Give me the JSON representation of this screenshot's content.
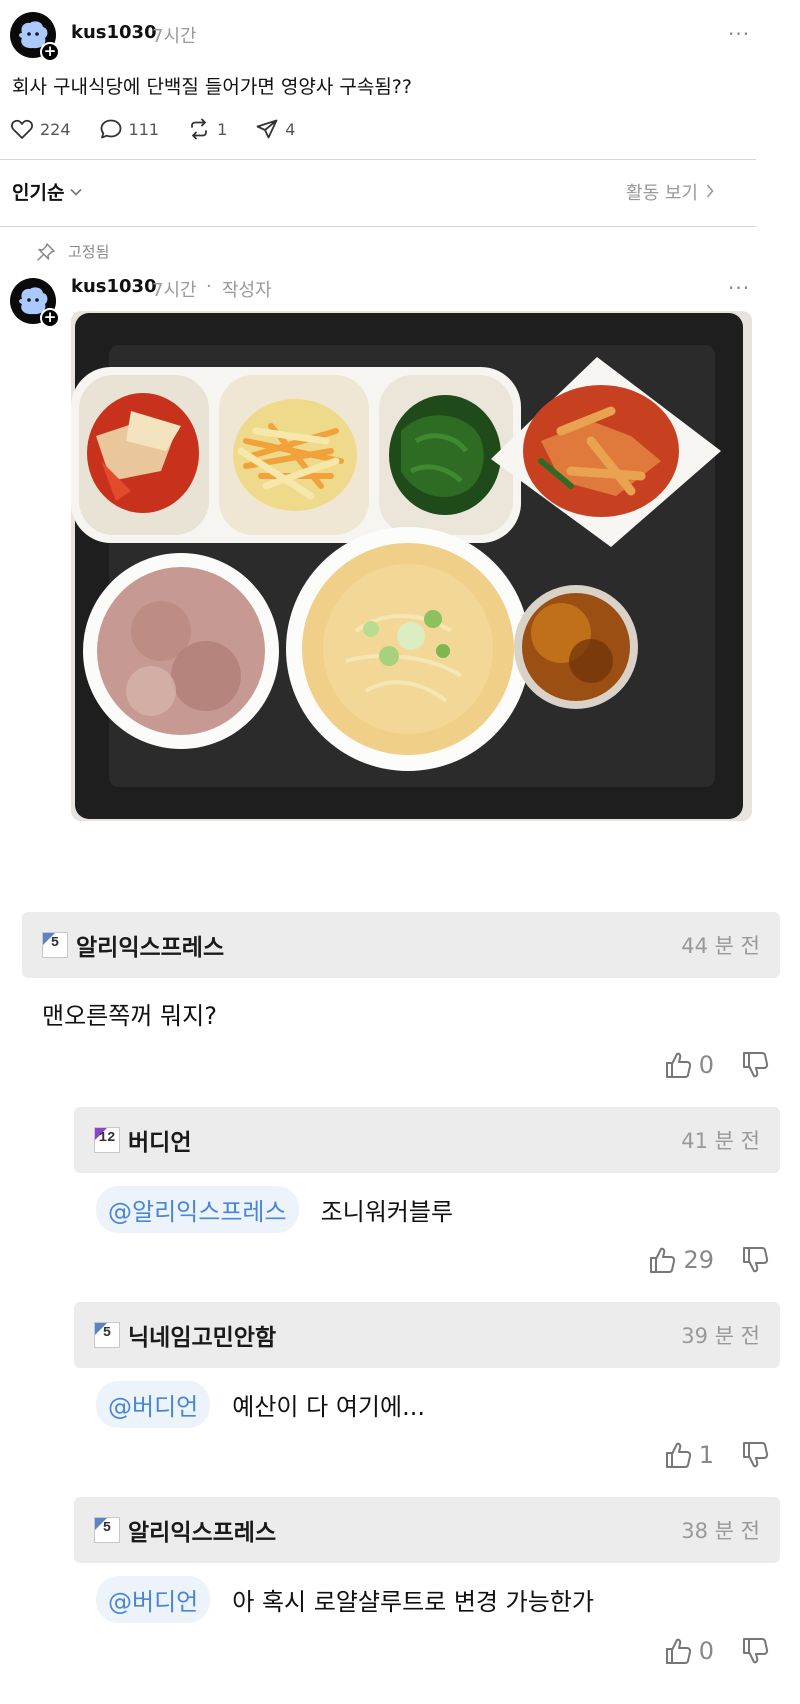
{
  "post": {
    "username": "kus1030",
    "time": "7시간",
    "more_label": "···",
    "title": "회사 구내식당에 단백질 들어가면 영양사 구속됨??",
    "likes": "224",
    "comments": "111",
    "reposts": "1",
    "shares": "4"
  },
  "sort": {
    "label": "인기순",
    "activity_label": "활동 보기"
  },
  "pinned_reply": {
    "pinned_label": "고정됨",
    "username": "kus1030",
    "time": "7시간",
    "separator": "·",
    "role": "작성자",
    "more_label": "···"
  },
  "comments": [
    {
      "level": "5",
      "name": "알리익스프레스",
      "time": "44 분 전",
      "mention": "",
      "text": "맨오른쪽꺼 뭐지?",
      "votes": "0"
    },
    {
      "level": "12",
      "name": "버디언",
      "time": "41 분 전",
      "mention": "@알리익스프레스",
      "text": "조니워커블루",
      "votes": "29"
    },
    {
      "level": "5",
      "name": "닉네임고민안함",
      "time": "39 분 전",
      "mention": "@버디언",
      "text": "예산이 다 여기에...",
      "votes": "1"
    },
    {
      "level": "5",
      "name": "알리익스프레스",
      "time": "38 분 전",
      "mention": "@버디언",
      "text": "아 혹시 로얄샬루트로 변경 가능한가",
      "votes": "0"
    }
  ],
  "colors": {
    "mention_text": "#4a86d6",
    "mention_bg": "#edf3fb",
    "comment_header_bg": "#ececec",
    "level_blue": "#5b84c4",
    "level_purple": "#8c45c9"
  }
}
